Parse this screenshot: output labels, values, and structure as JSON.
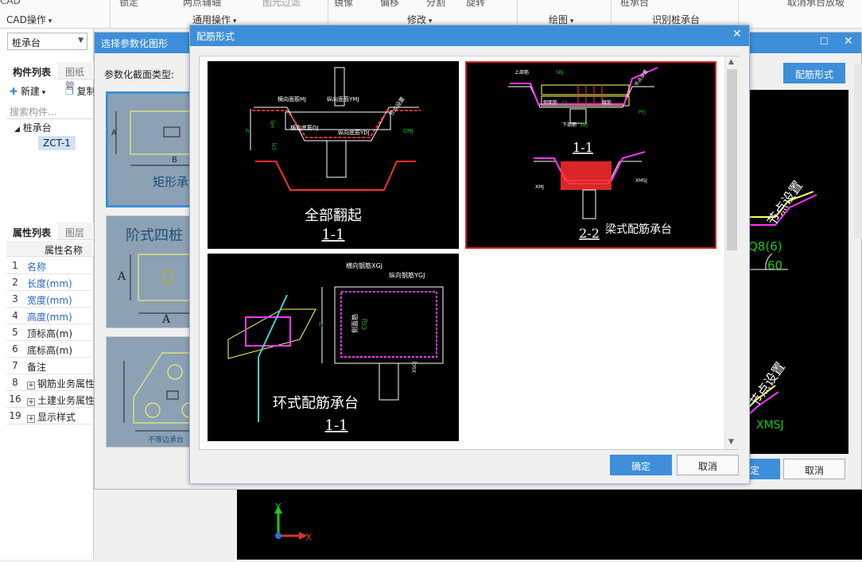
{
  "ribbon": {
    "groups": [
      "CAD操作",
      "通用操作",
      "修改",
      "绘图",
      "识别桩承台"
    ],
    "top_cut": [
      "锁定",
      "两点辅轴",
      "图元过滤",
      "镜像",
      "偏移",
      "分割",
      "旋转",
      "桩承台",
      "取消承台放坡"
    ]
  },
  "left_panel": {
    "type_combo": "桩承台",
    "tabs_top": [
      "构件列表",
      "图纸管"
    ],
    "toolbar": {
      "new": "新建",
      "copy": "复制"
    },
    "search_placeholder": "搜索构件...",
    "tree_root": "桩承台",
    "tree_child": "ZCT-1",
    "tabs_bottom": [
      "属性列表",
      "图层管"
    ],
    "prop_header": "属性名称",
    "props": [
      {
        "num": "1",
        "name": "名称",
        "blue": true
      },
      {
        "num": "2",
        "name": "长度(mm)",
        "blue": true
      },
      {
        "num": "3",
        "name": "宽度(mm)",
        "blue": true
      },
      {
        "num": "4",
        "name": "高度(mm)",
        "blue": true
      },
      {
        "num": "5",
        "name": "顶标高(m)",
        "blue": false
      },
      {
        "num": "6",
        "name": "底标高(m)",
        "blue": false
      },
      {
        "num": "7",
        "name": "备注",
        "blue": false
      },
      {
        "num": "8",
        "name": "钢筋业务属性",
        "blue": false,
        "group": true
      },
      {
        "num": "16",
        "name": "土建业务属性",
        "blue": false,
        "group": true
      },
      {
        "num": "19",
        "name": "显示样式",
        "blue": false,
        "group": true
      }
    ]
  },
  "param_dialog": {
    "title": "选择参数化图形",
    "section_label": "参数化截面类型:",
    "rebar_button": "配筋形式",
    "thumb_labels": [
      "矩形承台",
      "阶式四桩",
      "不等边承台"
    ],
    "confirm": "确定",
    "cancel": "取消",
    "preview_texts": [
      "节点设置",
      "Q8(6)",
      "60",
      "节点设置",
      "XMSJ"
    ]
  },
  "rebar_dialog": {
    "title": "配筋形式",
    "options": [
      {
        "caption": "全部翻起",
        "sub": "1-1",
        "labels": [
          "横向面筋MJ",
          "纵向面筋YMJ",
          "横向底筋DJ",
          "纵向底筋YDJ",
          "节点设置",
          "CMJ",
          "HPJ",
          "CPJ",
          "h"
        ]
      },
      {
        "caption": "梁式配筋承台",
        "sub": "1-1",
        "sub2": "2-2",
        "labels": [
          "上部筋",
          "SBJ",
          "节点设置",
          "侧面筋",
          "CJ",
          "腰筋",
          "下部筋",
          "XBJ",
          "PFJ",
          "XMSJ",
          "XMJ"
        ],
        "selected": true
      },
      {
        "caption": "环式配筋承台",
        "sub": "1-1",
        "labels": [
          "横向钢筋XGJ",
          "纵向钢筋YGJ",
          "侧面筋",
          "CGJ",
          "XSGJ",
          "h"
        ]
      }
    ],
    "confirm": "确定",
    "cancel": "取消"
  },
  "axes": {
    "y": "Y",
    "x": "X"
  }
}
